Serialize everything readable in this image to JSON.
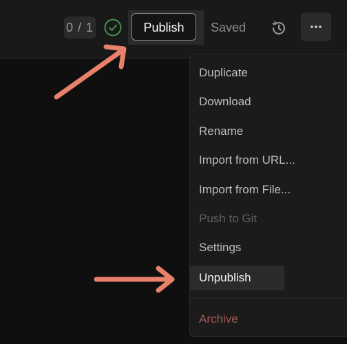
{
  "toolbar": {
    "counter": "0 / 1",
    "publish_label": "Publish",
    "saved_label": "Saved"
  },
  "menu": {
    "items": [
      {
        "label": "Duplicate",
        "state": "normal"
      },
      {
        "label": "Download",
        "state": "normal"
      },
      {
        "label": "Rename",
        "state": "normal"
      },
      {
        "label": "Import from URL...",
        "state": "normal"
      },
      {
        "label": "Import from File...",
        "state": "normal"
      },
      {
        "label": "Push to Git",
        "state": "disabled"
      },
      {
        "label": "Settings",
        "state": "normal"
      },
      {
        "label": "Unpublish",
        "state": "hovered"
      },
      {
        "label": "Archive",
        "state": "danger"
      }
    ]
  },
  "icons": {
    "status": "check-circle-icon",
    "history": "history-icon",
    "more": "more-horizontal-icon"
  },
  "annotations": {
    "arrow_color": "#e8806a"
  }
}
